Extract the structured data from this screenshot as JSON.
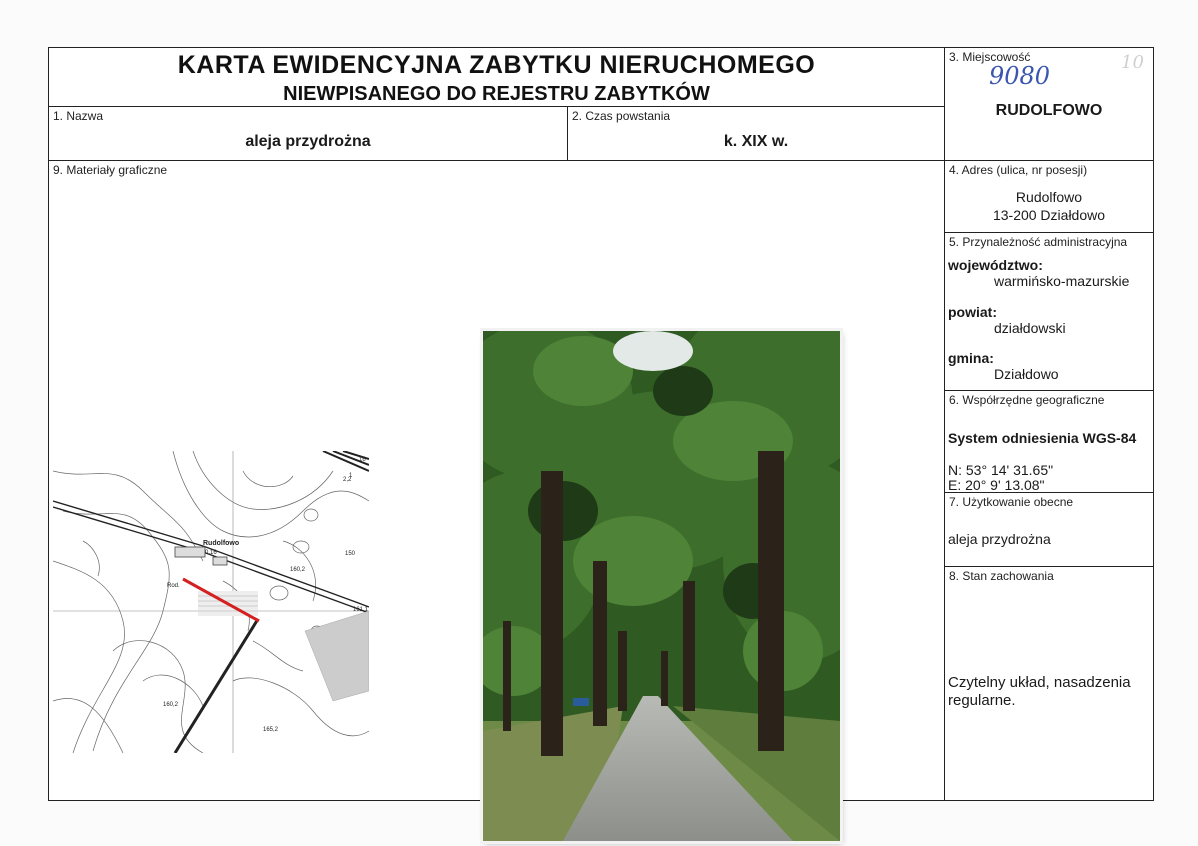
{
  "header": {
    "title": "KARTA EWIDENCYJNA ZABYTKU NIERUCHOMEGO",
    "subtitle": "NIEWPISANEGO DO REJESTRU ZABYTKÓW"
  },
  "fields": {
    "nazwa": {
      "label": "1. Nazwa",
      "value": "aleja przydrożna"
    },
    "czas": {
      "label": "2. Czas powstania",
      "value": "k. XIX w."
    },
    "miejscowosc": {
      "label": "3. Miejscowość",
      "value": "RUDOLFOWO",
      "handwritten_number": "9080",
      "handwritten_page": "10"
    },
    "adres": {
      "label": "4. Adres (ulica, nr posesji)",
      "line1": "Rudolfowo",
      "line2": "13-200 Działdowo"
    },
    "admin": {
      "label": "5. Przynależność administracyjna",
      "wojewodztwo_key": "województwo:",
      "wojewodztwo_val": "warmińsko-mazurskie",
      "powiat_key": "powiat:",
      "powiat_val": "działdowski",
      "gmina_key": "gmina:",
      "gmina_val": "Działdowo"
    },
    "wspolrzedne": {
      "label": "6. Współrzędne geograficzne",
      "system": "System odniesienia WGS-84",
      "n": "N: 53° 14' 31.65\"",
      "e": "E: 20° 9' 13.08\""
    },
    "uzytkowanie": {
      "label": "7. Użytkowanie obecne",
      "value": "aleja przydrożna"
    },
    "stan": {
      "label": "8. Stan zachowania",
      "value": "Czytelny układ, nasadzenia regularne."
    },
    "materialy": {
      "label": "9. Materiały graficzne"
    }
  },
  "map": {
    "place_label": "Rudolfowo",
    "sub_label": "0.16",
    "elev1": "160,2",
    "elev2": "161,1",
    "elev3": "165,2",
    "elev4": "160,2",
    "corner": "16",
    "small1": "1",
    "small2": "2,2",
    "small3": "Rod.",
    "small4": "150"
  },
  "colors": {
    "handwriting": "#3a56b0",
    "road_marker": "#d42020"
  }
}
